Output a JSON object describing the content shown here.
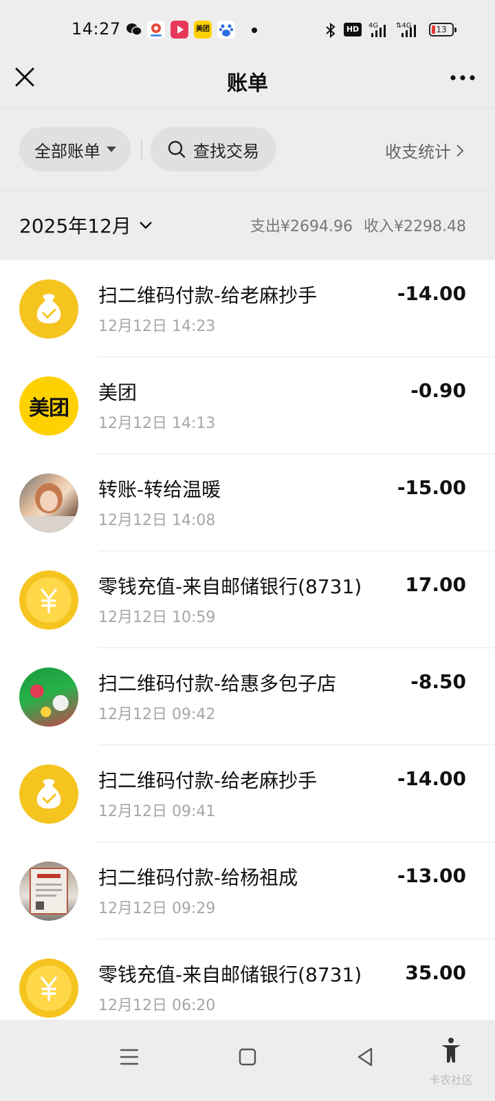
{
  "status_bar": {
    "time": "14:27",
    "app_icons": [
      "wechat-icon",
      "map-app-icon",
      "video-app-icon",
      "meituan-app-icon",
      "baidu-app-icon"
    ],
    "meituan_icon_text": "美团",
    "network": [
      "bluetooth-icon",
      "hd-icon",
      "4g-signal-icon",
      "4g-signal-icon"
    ],
    "hd_label": "HD",
    "battery_level": "13"
  },
  "header": {
    "title": "账单"
  },
  "filters": {
    "all_bills": "全部账单",
    "search": "查找交易",
    "stats": "收支统计"
  },
  "month": {
    "label": "2025年12月",
    "expense": "支出¥2694.96",
    "income": "收入¥2298.48"
  },
  "transactions": [
    {
      "title": "扫二维码付款-给老麻抄手",
      "time": "12月12日 14:23",
      "amount": "-14.00",
      "avatar": "money-bag-icon"
    },
    {
      "title": "美团",
      "time": "12月12日 14:13",
      "amount": "-0.90",
      "avatar": "meituan-logo",
      "avatar_text": "美团"
    },
    {
      "title": "转账-转给温暖",
      "time": "12月12日 14:08",
      "amount": "-15.00",
      "avatar": "user-photo"
    },
    {
      "title": "零钱充值-来自邮储银行(8731)",
      "time": "12月12日 10:59",
      "amount": "17.00",
      "avatar": "yuan-coin-icon"
    },
    {
      "title": "扫二维码付款-给惠多包子店",
      "time": "12月12日 09:42",
      "amount": "-8.50",
      "avatar": "merchant-photo"
    },
    {
      "title": "扫二维码付款-给老麻抄手",
      "time": "12月12日 09:41",
      "amount": "-14.00",
      "avatar": "money-bag-icon"
    },
    {
      "title": "扫二维码付款-给杨祖成",
      "time": "12月12日 09:29",
      "amount": "-13.00",
      "avatar": "merchant-photo"
    },
    {
      "title": "零钱充值-来自邮储银行(8731)",
      "time": "12月12日 06:20",
      "amount": "35.00",
      "avatar": "yuan-coin-icon"
    }
  ],
  "watermark": "卡农社区"
}
